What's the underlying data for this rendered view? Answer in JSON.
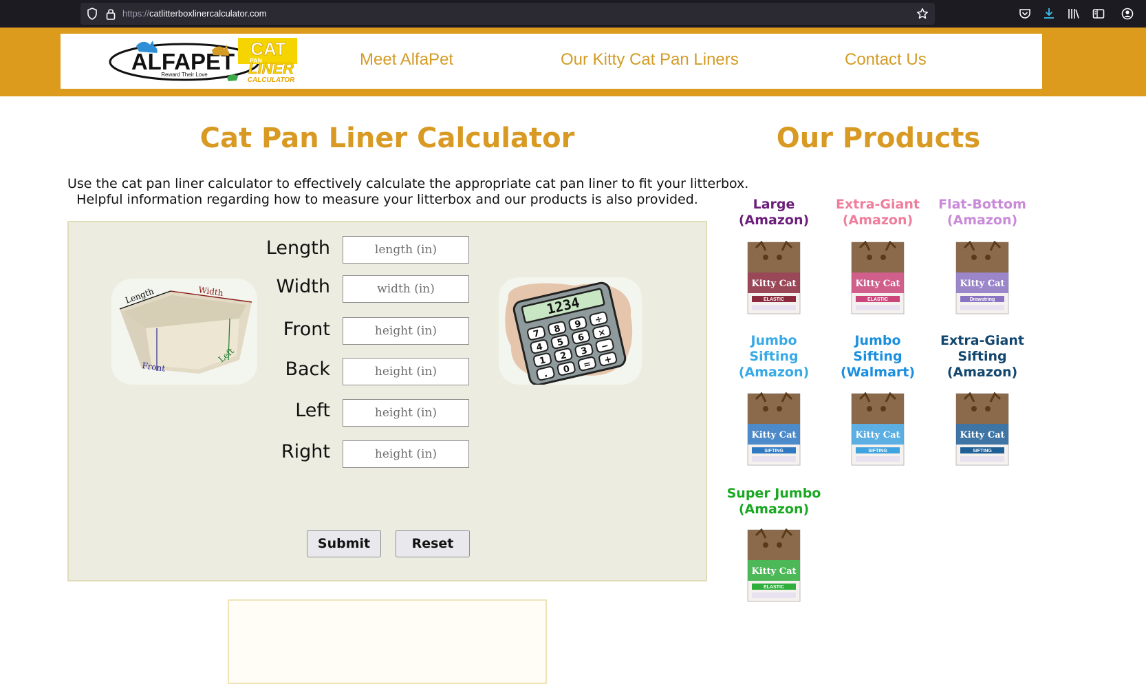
{
  "browser": {
    "url_protocol": "https://",
    "url_host": "catlitterboxlinercalculator.com"
  },
  "logo": {
    "brand": "ALFAPET",
    "tagline": "Reward Their Love",
    "badge_line1": "CAT",
    "badge_line2": "PAN",
    "badge_line3": "LINER",
    "badge_line4": "CALCULATOR"
  },
  "nav": {
    "meet": "Meet AlfaPet",
    "liners": "Our Kitty Cat Pan Liners",
    "contact": "Contact Us"
  },
  "main": {
    "title": "Cat Pan Liner Calculator",
    "intro_line1": "Use the cat pan liner calculator to effectively calculate the appropriate cat pan liner to fit your litterbox.",
    "intro_line2": "Helpful information regarding how to measure your litterbox and our products is also provided."
  },
  "diagram": {
    "length": "Length",
    "width": "Width",
    "front": "Front",
    "left": "Left"
  },
  "calculator_display": "1234",
  "calculator_keys": [
    "7",
    "8",
    "9",
    "÷",
    "4",
    "5",
    "6",
    "×",
    "1",
    "2",
    "3",
    "−",
    ".",
    "0",
    "=",
    "+"
  ],
  "form": {
    "fields": [
      {
        "label": "Length",
        "placeholder": "length (in)"
      },
      {
        "label": "Width",
        "placeholder": "width (in)"
      },
      {
        "label": "Front",
        "placeholder": "height (in)"
      },
      {
        "label": "Back",
        "placeholder": "height (in)"
      },
      {
        "label": "Left",
        "placeholder": "height (in)"
      },
      {
        "label": "Right",
        "placeholder": "height (in)"
      }
    ],
    "submit": "Submit",
    "reset": "Reset"
  },
  "products": {
    "title": "Our Products",
    "items": [
      {
        "line1": "Large",
        "line2": "(Amazon)",
        "line3": "",
        "color": "#6b1f7a",
        "box_color": "#8a2a3c",
        "badge": "ELASTIC"
      },
      {
        "line1": "Extra-Giant",
        "line2": "(Amazon)",
        "line3": "",
        "color": "#ef7e9c",
        "box_color": "#c9457a",
        "badge": "ELASTIC"
      },
      {
        "line1": "Flat-Bottom",
        "line2": "(Amazon)",
        "line3": "",
        "color": "#c98ad8",
        "box_color": "#8a73c2",
        "badge": "Drawstring"
      },
      {
        "line1": "Jumbo",
        "line2": "Sifting",
        "line3": "(Amazon)",
        "color": "#36a9e6",
        "box_color": "#2f78c2",
        "badge": "SIFTING"
      },
      {
        "line1": "Jumbo",
        "line2": "Sifting",
        "line3": "(Walmart)",
        "color": "#1a8fe0",
        "box_color": "#3fa3e0",
        "badge": "SIFTING"
      },
      {
        "line1": "Extra-Giant",
        "line2": "Sifting",
        "line3": "(Amazon)",
        "color": "#12466e",
        "box_color": "#1e5f96",
        "badge": "SIFTING"
      },
      {
        "line1": "Super Jumbo",
        "line2": "(Amazon)",
        "line3": "",
        "color": "#1aa822",
        "box_color": "#2fae3c",
        "badge": "ELASTIC"
      }
    ]
  }
}
